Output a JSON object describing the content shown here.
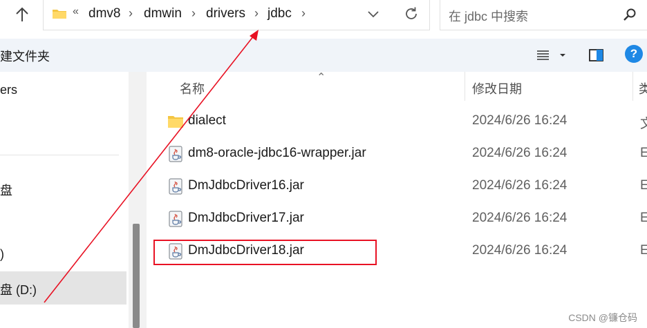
{
  "address_bar": {
    "overflow": "«",
    "crumbs": [
      "dmv8",
      "dmwin",
      "drivers",
      "jdbc"
    ]
  },
  "search": {
    "placeholder": "在 jdbc 中搜索"
  },
  "toolbar": {
    "new_folder": "建文件夹",
    "help": "?"
  },
  "nav": {
    "items": [
      {
        "label": "ers"
      },
      {
        "label": "盘"
      },
      {
        "label": ")"
      },
      {
        "label": "盘 (D:)"
      }
    ]
  },
  "columns": {
    "name": "名称",
    "date_modified": "修改日期",
    "type": "类"
  },
  "files": [
    {
      "name": "dialect",
      "date": "2024/6/26 16:24",
      "type": "文",
      "icon": "folder-icon"
    },
    {
      "name": "dm8-oracle-jdbc16-wrapper.jar",
      "date": "2024/6/26 16:24",
      "type": "E",
      "icon": "java-jar-icon"
    },
    {
      "name": "DmJdbcDriver16.jar",
      "date": "2024/6/26 16:24",
      "type": "E",
      "icon": "java-jar-icon"
    },
    {
      "name": "DmJdbcDriver17.jar",
      "date": "2024/6/26 16:24",
      "type": "E",
      "icon": "java-jar-icon"
    },
    {
      "name": "DmJdbcDriver18.jar",
      "date": "2024/6/26 16:24",
      "type": "E",
      "icon": "java-jar-icon"
    }
  ],
  "annotation": {
    "color": "#e81123"
  },
  "watermark": "CSDN @镰仓码"
}
